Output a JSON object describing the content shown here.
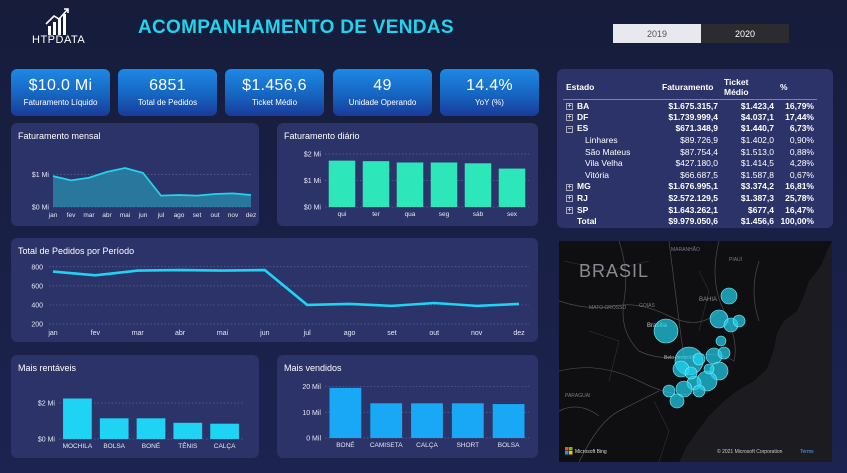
{
  "header": {
    "logo_text": "HTPDATA",
    "title": "ACOMPANHAMENTO DE VENDAS",
    "years": [
      "2019",
      "2020"
    ],
    "selected_year": "2020"
  },
  "kpis": [
    {
      "value": "$10.0 Mi",
      "label": "Faturamento Líquido"
    },
    {
      "value": "6851",
      "label": "Total de Pedidos"
    },
    {
      "value": "$1.456,6",
      "label": "Ticket Médio"
    },
    {
      "value": "49",
      "label": "Unidade Operando"
    },
    {
      "value": "14.4%",
      "label": "YoY (%)"
    }
  ],
  "panels": {
    "monthly": "Faturamento mensal",
    "daily": "Faturamento diário",
    "orders": "Total de Pedidos por Período",
    "profitable": "Mais rentáveis",
    "sold": "Mais vendidos"
  },
  "table": {
    "headers": [
      "Estado",
      "Faturamento",
      "Ticket Médio",
      "%"
    ],
    "rows": [
      {
        "name": "BA",
        "level": 0,
        "expand": "+",
        "faturamento": "$1.675.315,7",
        "ticket": "$1.423,4",
        "pct": "16,79%"
      },
      {
        "name": "DF",
        "level": 0,
        "expand": "+",
        "faturamento": "$1.739.999,4",
        "ticket": "$4.037,1",
        "pct": "17,44%"
      },
      {
        "name": "ES",
        "level": 0,
        "expand": "−",
        "faturamento": "$671.348,9",
        "ticket": "$1.440,7",
        "pct": "6,73%"
      },
      {
        "name": "Linhares",
        "level": 1,
        "expand": "",
        "faturamento": "$89.726,9",
        "ticket": "$1.402,0",
        "pct": "0,90%"
      },
      {
        "name": "São Mateus",
        "level": 1,
        "expand": "",
        "faturamento": "$87.754,4",
        "ticket": "$1.513,0",
        "pct": "0,88%"
      },
      {
        "name": "Vila Velha",
        "level": 1,
        "expand": "",
        "faturamento": "$427.180,0",
        "ticket": "$1.414,5",
        "pct": "4,28%"
      },
      {
        "name": "Vitória",
        "level": 1,
        "expand": "",
        "faturamento": "$66.687,5",
        "ticket": "$1.587,8",
        "pct": "0,67%"
      },
      {
        "name": "MG",
        "level": 0,
        "expand": "+",
        "faturamento": "$1.676.995,1",
        "ticket": "$3.374,2",
        "pct": "16,81%"
      },
      {
        "name": "RJ",
        "level": 0,
        "expand": "+",
        "faturamento": "$2.572.129,5",
        "ticket": "$1.387,3",
        "pct": "25,78%"
      },
      {
        "name": "SP",
        "level": 0,
        "expand": "+",
        "faturamento": "$1.643.262,1",
        "ticket": "$677,4",
        "pct": "16,47%"
      }
    ],
    "total": {
      "name": "Total",
      "faturamento": "$9.979.050,6",
      "ticket": "$1.456,6",
      "pct": "100,00%"
    }
  },
  "map": {
    "country_label": "BRASIL",
    "labels": [
      "MARANHÃO",
      "PIAUÍ",
      "BAHIA",
      "MATO GROSSO",
      "GOIÁS",
      "Brasília",
      "Belo Horizonte",
      "PARAGUAI"
    ],
    "footer": "© 2021 Microsoft Corporation",
    "terms": "Terms",
    "brand": "Microsoft Bing"
  },
  "chart_data": [
    {
      "type": "area",
      "title": "Faturamento mensal",
      "categories": [
        "jan",
        "fev",
        "mar",
        "abr",
        "mai",
        "jun",
        "jul",
        "ago",
        "set",
        "out",
        "nov",
        "dez"
      ],
      "values": [
        0.95,
        0.82,
        0.9,
        1.08,
        1.2,
        1.05,
        0.35,
        0.37,
        0.35,
        0.4,
        0.42,
        0.37
      ],
      "y_ticks": [
        "$0 Mi",
        "$1 Mi"
      ],
      "ylim": [
        0,
        1.6
      ]
    },
    {
      "type": "bar",
      "title": "Faturamento diário",
      "categories": [
        "qui",
        "ter",
        "qua",
        "seg",
        "sáb",
        "sex"
      ],
      "values": [
        1.75,
        1.73,
        1.68,
        1.68,
        1.65,
        1.45
      ],
      "y_ticks": [
        "$0 Mi",
        "$1 Mi",
        "$2 Mi"
      ],
      "ylim": [
        0,
        2
      ]
    },
    {
      "type": "line",
      "title": "Total de Pedidos por Período",
      "categories": [
        "jan",
        "fev",
        "mar",
        "abr",
        "mai",
        "jun",
        "jul",
        "ago",
        "set",
        "out",
        "nov",
        "dez"
      ],
      "values": [
        750,
        710,
        760,
        765,
        760,
        765,
        400,
        410,
        390,
        420,
        390,
        410
      ],
      "y_ticks": [
        "200",
        "400",
        "600",
        "800"
      ],
      "ylim": [
        200,
        850
      ]
    },
    {
      "type": "bar",
      "title": "Mais rentáveis",
      "categories": [
        "MOCHILA",
        "BOLSA",
        "BONÉ",
        "TÊNIS",
        "CALÇA"
      ],
      "values": [
        2.25,
        1.15,
        1.15,
        0.9,
        0.85
      ],
      "y_ticks": [
        "$0 Mi",
        "$2 Mi"
      ],
      "ylim": [
        0,
        3
      ]
    },
    {
      "type": "bar",
      "title": "Mais vendidos",
      "categories": [
        "BONÉ",
        "CAMISETA",
        "CALÇA",
        "SHORT",
        "BOLSA"
      ],
      "values": [
        19.5,
        13.5,
        13.5,
        13.5,
        13.2
      ],
      "y_ticks": [
        "0 Mil",
        "10 Mil",
        "20 Mil"
      ],
      "ylim": [
        0,
        21
      ]
    }
  ],
  "colors": {
    "accent": "#22d3ee",
    "bar_green": "#2de6b9",
    "bar_cyan": "#1fd3f5",
    "bar_blue": "#18a8f5",
    "panel": "#2b3368"
  }
}
